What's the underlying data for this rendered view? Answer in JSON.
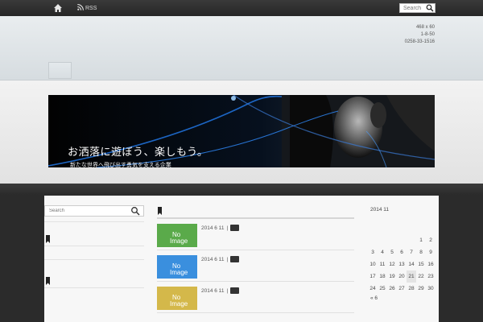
{
  "topbar": {
    "rss_label": "RSS",
    "search_placeholder": "Search"
  },
  "header": {
    "info_lines": [
      "468 x 60",
      "1-8-50",
      "0258-33-1516"
    ]
  },
  "banner": {
    "title": "お洒落に遊ぼう、楽しもう。",
    "subtitle": "新たな世界へ飛び出す勇気を支える企業"
  },
  "sidebar": {
    "search_placeholder": "Search"
  },
  "posts": [
    {
      "thumb_line1": "No",
      "thumb_line2": "Image",
      "thumb_color": "#5aaa4a",
      "date": "2014 6 11",
      "sep": "|"
    },
    {
      "thumb_line1": "No",
      "thumb_line2": "Image",
      "thumb_color": "#3a8fde",
      "date": "2014 6 11",
      "sep": "|"
    },
    {
      "thumb_line1": "No",
      "thumb_line2": "Image",
      "thumb_color": "#d4b84a",
      "date": "2014 6 11",
      "sep": "|"
    }
  ],
  "calendar": {
    "title": "2014 11",
    "weeks": [
      [
        "",
        "",
        "",
        "",
        "",
        "1",
        "2"
      ],
      [
        "3",
        "4",
        "5",
        "6",
        "7",
        "8",
        "9"
      ],
      [
        "10",
        "11",
        "12",
        "13",
        "14",
        "15",
        "16"
      ],
      [
        "17",
        "18",
        "19",
        "20",
        "21",
        "22",
        "23"
      ],
      [
        "24",
        "25",
        "26",
        "27",
        "28",
        "29",
        "30"
      ]
    ],
    "today": "21",
    "prev_link": "« 6"
  },
  "colors": {
    "topbar": "#2e2e2e",
    "header": "#e2e7ea",
    "footer_bg": "#2b2b2b"
  }
}
